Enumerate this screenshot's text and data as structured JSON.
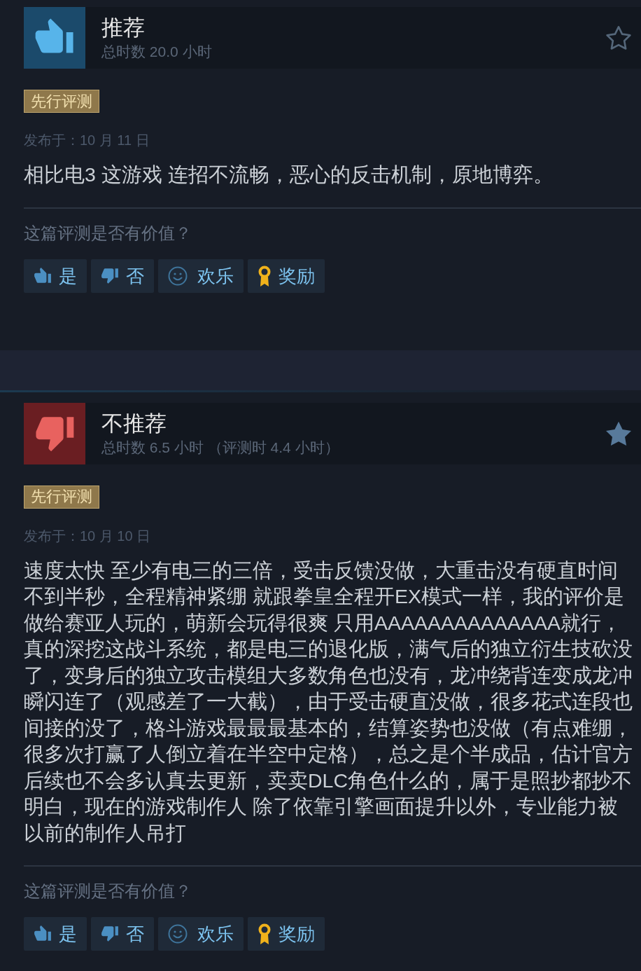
{
  "reviews": [
    {
      "recommended": true,
      "title": "推荐",
      "hours": "总时数 20.0 小时",
      "starred": false,
      "badge": "先行评测",
      "date": "发布于：10 月 11 日",
      "body": "相比电3 这游戏 连招不流畅，恶心的反击机制，原地博弈。",
      "helpful_prompt": "这篇评测是否有价值？",
      "buttons": [
        {
          "kind": "yes",
          "label": "是"
        },
        {
          "kind": "no",
          "label": "否"
        },
        {
          "kind": "funny",
          "label": "欢乐"
        },
        {
          "kind": "award",
          "label": "奖励"
        }
      ]
    },
    {
      "recommended": false,
      "title": "不推荐",
      "hours": "总时数 6.5 小时 （评测时 4.4 小时）",
      "starred": true,
      "badge": "先行评测",
      "date": "发布于：10 月 10 日",
      "body": "速度太快 至少有电三的三倍，受击反馈没做，大重击没有硬直时间不到半秒，全程精神紧绷 就跟拳皇全程开EX模式一样，我的评价是做给赛亚人玩的，萌新会玩得很爽 只用AAAAAAAAAAAAAA就行，真的深挖这战斗系统，都是电三的退化版，满气后的独立衍生技砍没了，变身后的独立攻击模组大多数角色也没有，龙冲绕背连变成龙冲瞬闪连了（观感差了一大截），由于受击硬直没做，很多花式连段也间接的没了，格斗游戏最最最基本的，结算姿势也没做（有点难绷，很多次打赢了人倒立着在半空中定格），总之是个半成品，估计官方后续也不会多认真去更新，卖卖DLC角色什么的，属于是照抄都抄不明白，现在的游戏制作人 除了依靠引擎画面提升以外，专业能力被以前的制作人吊打",
      "helpful_prompt": "这篇评测是否有价值？",
      "buttons": [
        {
          "kind": "yes",
          "label": "是"
        },
        {
          "kind": "no",
          "label": "否"
        },
        {
          "kind": "funny",
          "label": "欢乐"
        },
        {
          "kind": "award",
          "label": "奖励"
        }
      ]
    }
  ]
}
